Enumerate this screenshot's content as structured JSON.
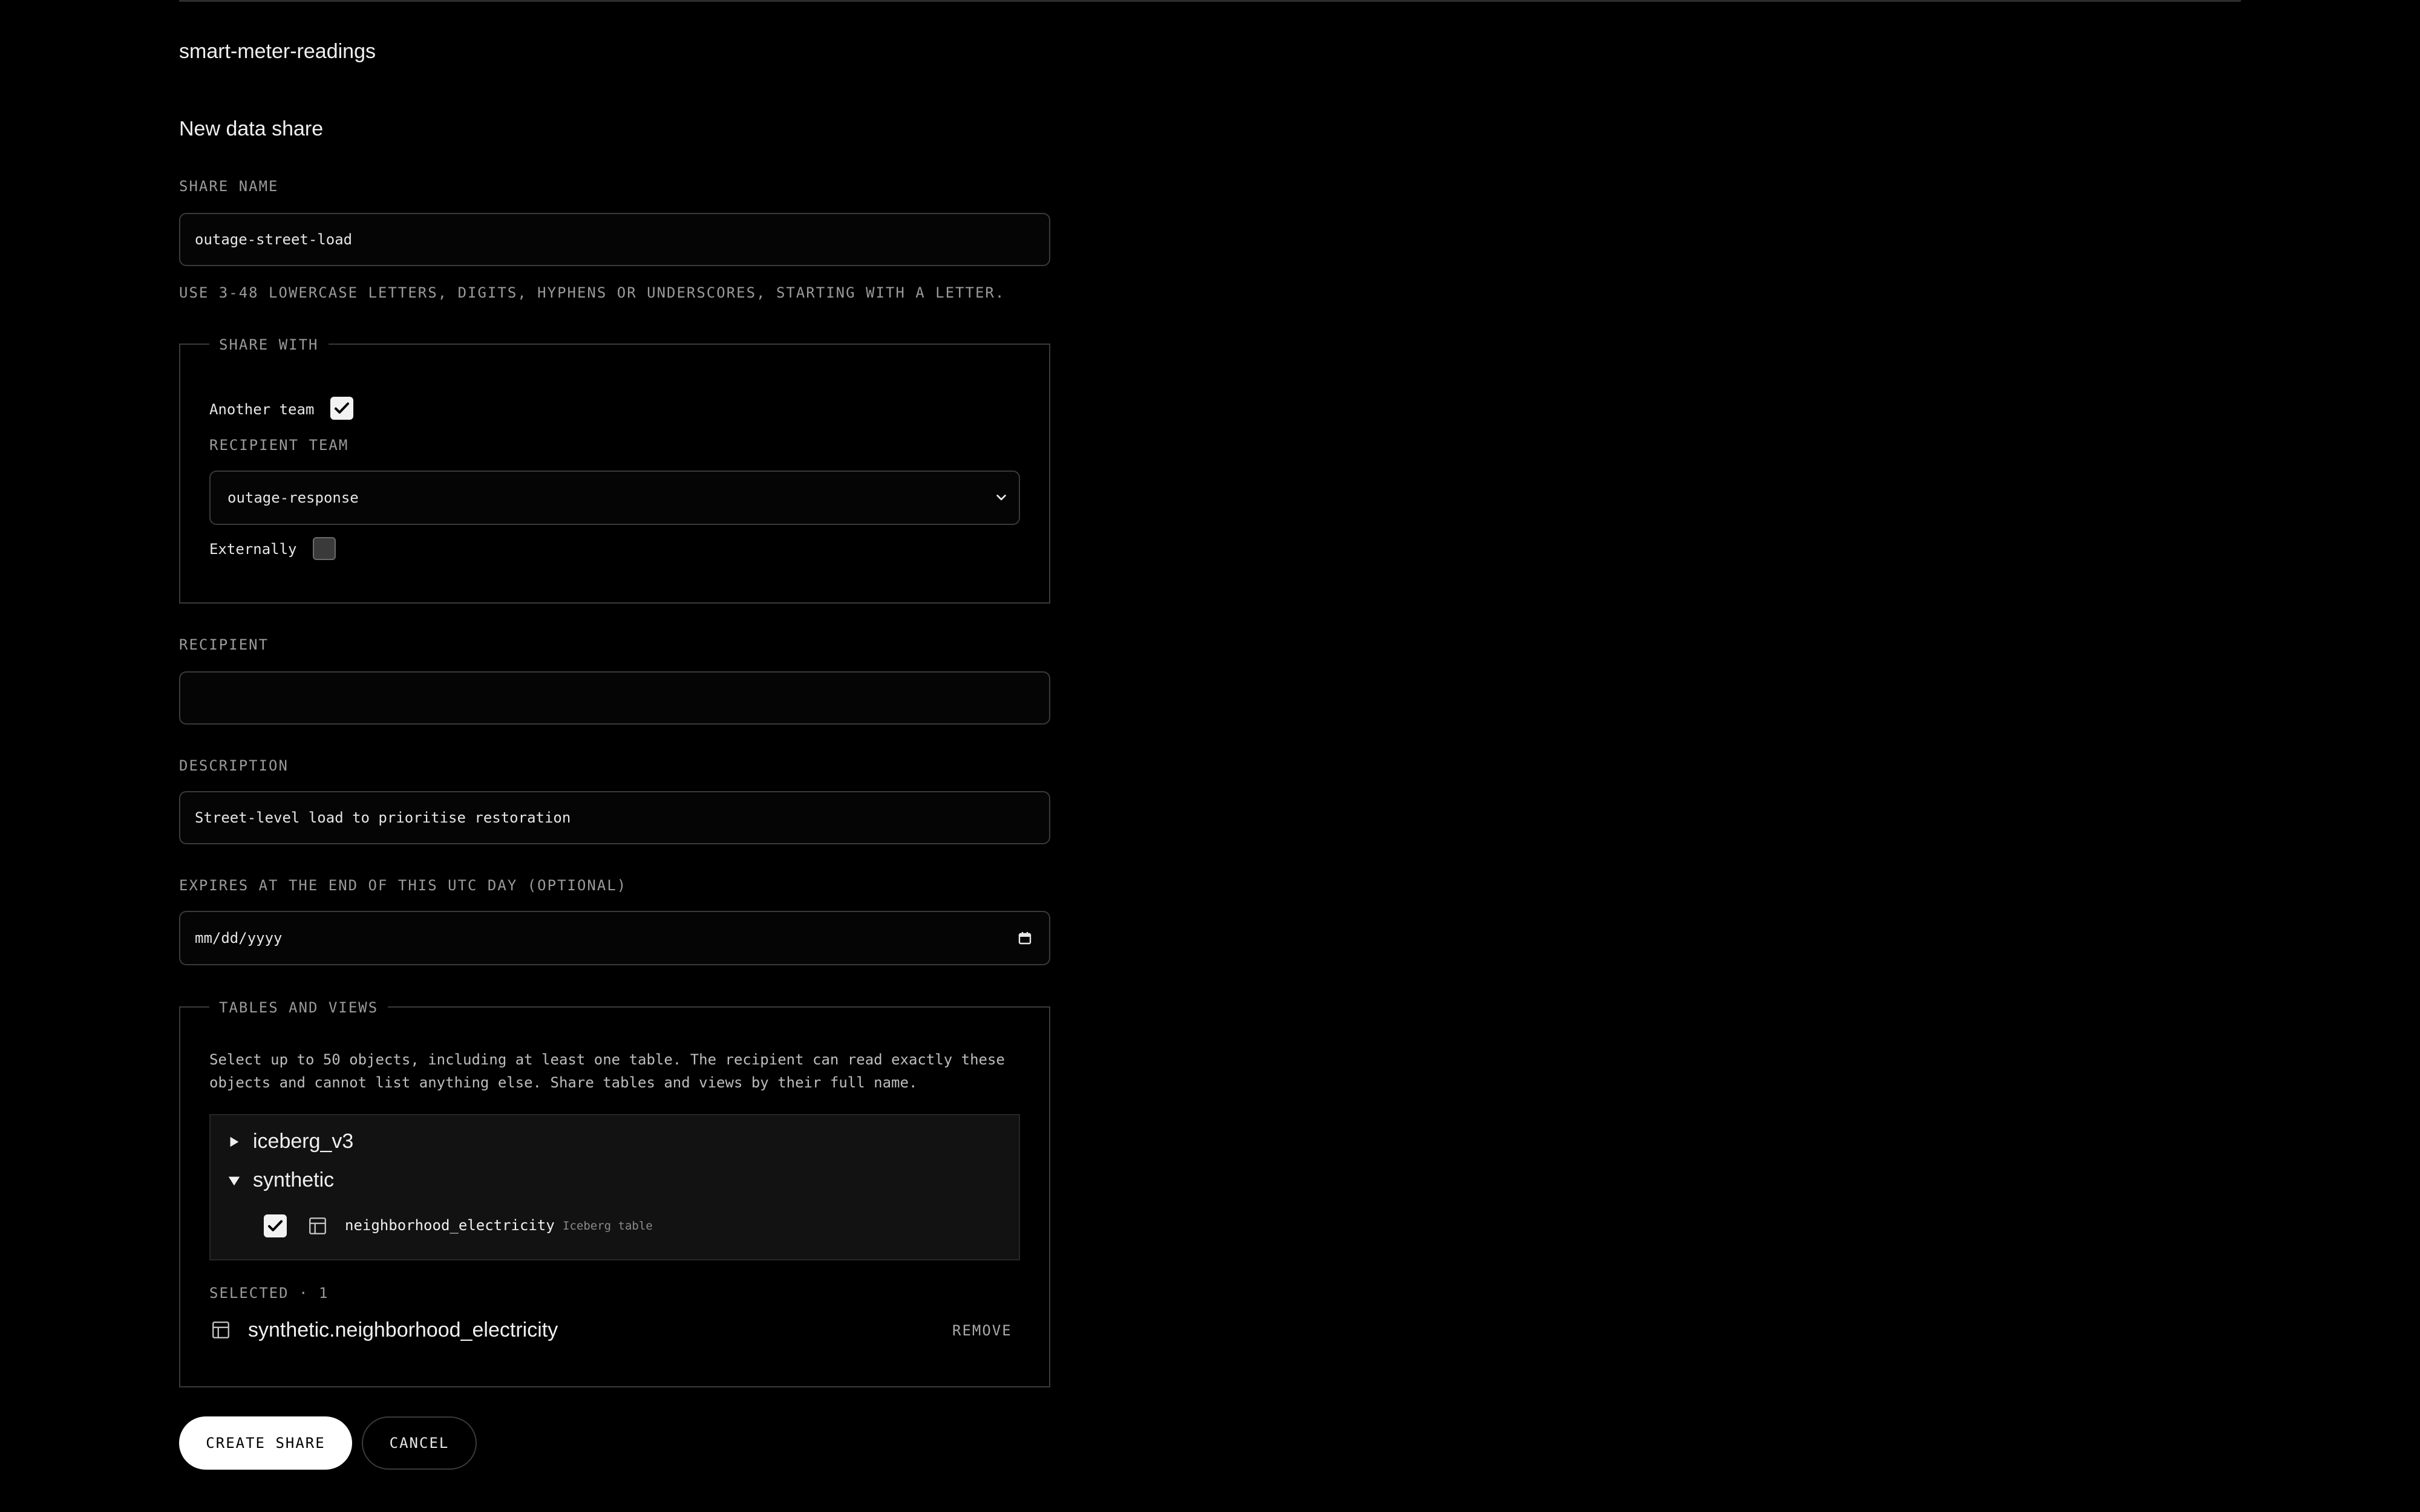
{
  "page": {
    "heading": "smart-meter-readings",
    "form_title": "New data share"
  },
  "share_name": {
    "label": "SHARE NAME",
    "value": "outage-street-load",
    "hint": "USE 3-48 LOWERCASE LETTERS, DIGITS, HYPHENS OR UNDERSCORES, STARTING WITH A LETTER."
  },
  "share_with": {
    "legend": "SHARE WITH",
    "another_team": {
      "label": "Another team",
      "checked": true
    },
    "recipient_team": {
      "label": "RECIPIENT TEAM",
      "selected": "outage-response"
    },
    "externally": {
      "label": "Externally",
      "checked": false
    }
  },
  "recipient": {
    "label": "RECIPIENT",
    "value": ""
  },
  "description": {
    "label": "DESCRIPTION",
    "value": "Street-level load to prioritise restoration"
  },
  "expires": {
    "label": "EXPIRES AT THE END OF THIS UTC DAY (OPTIONAL)",
    "placeholder": "mm/dd/yyyy"
  },
  "tables": {
    "legend": "TABLES AND VIEWS",
    "help_line1": "Select up to 50 objects, including at least one table. The recipient can read exactly these",
    "help_line2": "objects and cannot list anything else. Share tables and views by their full name.",
    "tree": [
      {
        "name": "iceberg_v3",
        "expanded": false
      },
      {
        "name": "synthetic",
        "expanded": true,
        "children": [
          {
            "name": "neighborhood_electricity",
            "type": "Iceberg table",
            "checked": true
          }
        ]
      }
    ],
    "selected_label": "SELECTED · 1",
    "selected_items": [
      {
        "name": "synthetic.neighborhood_electricity",
        "remove_label": "REMOVE"
      }
    ]
  },
  "actions": {
    "create_label": "CREATE SHARE",
    "cancel_label": "CANCEL"
  },
  "icons": {
    "check": "checkmark-icon",
    "table": "table-icon",
    "caret_right": "caret-right-icon",
    "caret_down": "caret-down-icon",
    "chevron": "chevron-down-icon",
    "calendar": "calendar-icon"
  },
  "colors": {
    "background": "#000000",
    "border": "#3a3a3a",
    "text": "#e8e8e8",
    "muted": "#9a9a9a",
    "primary_button": "#ffffff"
  }
}
